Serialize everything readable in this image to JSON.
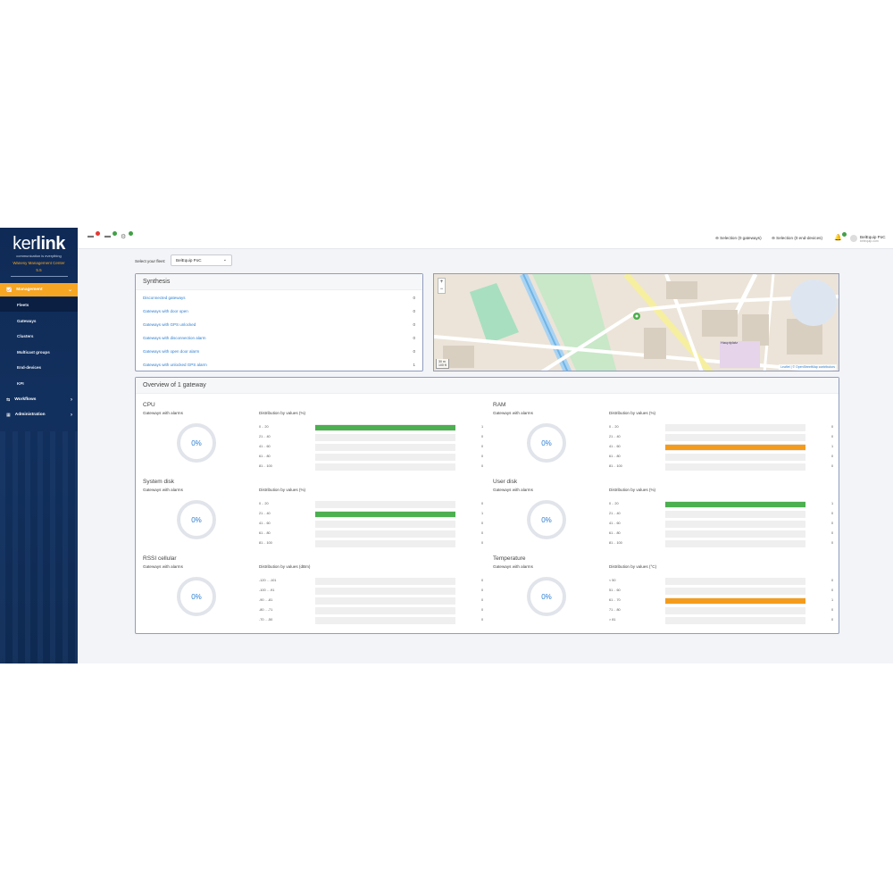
{
  "sidebar": {
    "brand_light": "ker",
    "brand_bold": "link",
    "tagline": "communication is everything",
    "product_line1": "Wanesy Management Center",
    "product_line2": "5.5",
    "sections": [
      {
        "label": "Management",
        "icon": "chart-line-icon",
        "active": true,
        "chevron": "⌄"
      },
      {
        "label": "Workflows",
        "icon": "workflow-icon",
        "active": false,
        "chevron": "›"
      },
      {
        "label": "Administration",
        "icon": "grid-icon",
        "active": false,
        "chevron": "›"
      }
    ],
    "items": [
      {
        "label": "Fleets",
        "active": true
      },
      {
        "label": "Gateways",
        "active": false
      },
      {
        "label": "Clusters",
        "active": false
      },
      {
        "label": "Multicast groups",
        "active": false
      },
      {
        "label": "End-devices",
        "active": false
      },
      {
        "label": "KPI",
        "active": false
      }
    ]
  },
  "topbar": {
    "icons": [
      {
        "name": "gateway-alarm-icon",
        "badge_color": "#e53935"
      },
      {
        "name": "gateway-status-icon",
        "badge_color": "#43a047"
      },
      {
        "name": "device-status-icon",
        "badge_color": "#43a047"
      }
    ],
    "selection_gateways": "Selection (0 gateways)",
    "selection_enddevices": "Selection (0 end-devices)",
    "user_name": "BelEquip PoC",
    "user_sub": "belequip.com"
  },
  "fleet": {
    "label": "Select your fleet:",
    "value": "BelEquip PoC"
  },
  "synthesis": {
    "title": "Synthesis",
    "rows": [
      {
        "label": "Disconnected gateways",
        "value": "0"
      },
      {
        "label": "Gateways with door open",
        "value": "0"
      },
      {
        "label": "Gateways with GPS unlocked",
        "value": "0"
      },
      {
        "label": "Gateways with disconnection alarm",
        "value": "0"
      },
      {
        "label": "Gateways with open door alarm",
        "value": "0"
      },
      {
        "label": "Gateways with unlocked GPS alarm",
        "value": "1"
      }
    ]
  },
  "map": {
    "zoom_in": "+",
    "zoom_out": "−",
    "scale_top": "30 m",
    "scale_bottom": "100 ft",
    "attribution": "Leaflet | © OpenStreetMap contributors",
    "place_hauptplatz": "Hauptplatz"
  },
  "overview": {
    "title": "Overview of 1 gateway",
    "alarms_label": "Gateways with alarms",
    "metrics": [
      {
        "title": "CPU",
        "percent": "0%",
        "dist_label": "Distribution by values (%)",
        "rows": [
          {
            "range": "0 .. 20",
            "count": "1",
            "fraction": 1,
            "color": "#4caf50"
          },
          {
            "range": "21 .. 40",
            "count": "0",
            "fraction": 0,
            "color": "#4caf50"
          },
          {
            "range": "41 .. 60",
            "count": "0",
            "fraction": 0,
            "color": "#4caf50"
          },
          {
            "range": "61 .. 80",
            "count": "0",
            "fraction": 0,
            "color": "#4caf50"
          },
          {
            "range": "81 .. 100",
            "count": "0",
            "fraction": 0,
            "color": "#4caf50"
          }
        ]
      },
      {
        "title": "RAM",
        "percent": "0%",
        "dist_label": "Distribution by values (%)",
        "rows": [
          {
            "range": "0 .. 20",
            "count": "0",
            "fraction": 0,
            "color": "#f59b1b"
          },
          {
            "range": "21 .. 40",
            "count": "0",
            "fraction": 0,
            "color": "#f59b1b"
          },
          {
            "range": "41 .. 60",
            "count": "1",
            "fraction": 1,
            "color": "#f59b1b"
          },
          {
            "range": "61 .. 80",
            "count": "0",
            "fraction": 0,
            "color": "#f59b1b"
          },
          {
            "range": "81 .. 100",
            "count": "0",
            "fraction": 0,
            "color": "#f59b1b"
          }
        ]
      },
      {
        "title": "System disk",
        "percent": "0%",
        "dist_label": "Distribution by values (%)",
        "rows": [
          {
            "range": "0 .. 20",
            "count": "0",
            "fraction": 0,
            "color": "#4caf50"
          },
          {
            "range": "21 .. 40",
            "count": "1",
            "fraction": 1,
            "color": "#4caf50"
          },
          {
            "range": "41 .. 60",
            "count": "0",
            "fraction": 0,
            "color": "#4caf50"
          },
          {
            "range": "61 .. 80",
            "count": "0",
            "fraction": 0,
            "color": "#4caf50"
          },
          {
            "range": "81 .. 100",
            "count": "0",
            "fraction": 0,
            "color": "#4caf50"
          }
        ]
      },
      {
        "title": "User disk",
        "percent": "0%",
        "dist_label": "Distribution by values (%)",
        "rows": [
          {
            "range": "0 .. 20",
            "count": "1",
            "fraction": 1,
            "color": "#4caf50"
          },
          {
            "range": "21 .. 40",
            "count": "0",
            "fraction": 0,
            "color": "#4caf50"
          },
          {
            "range": "41 .. 60",
            "count": "0",
            "fraction": 0,
            "color": "#4caf50"
          },
          {
            "range": "61 .. 80",
            "count": "0",
            "fraction": 0,
            "color": "#4caf50"
          },
          {
            "range": "81 .. 100",
            "count": "0",
            "fraction": 0,
            "color": "#4caf50"
          }
        ]
      },
      {
        "title": "RSSI cellular",
        "percent": "0%",
        "dist_label": "Distribution by values (dBm)",
        "rows": [
          {
            "range": "-120 .. -101",
            "count": "0",
            "fraction": 0,
            "color": "#4caf50"
          },
          {
            "range": "-100 .. -91",
            "count": "0",
            "fraction": 0,
            "color": "#4caf50"
          },
          {
            "range": "-90 .. -81",
            "count": "0",
            "fraction": 0,
            "color": "#4caf50"
          },
          {
            "range": "-80 .. -71",
            "count": "0",
            "fraction": 0,
            "color": "#4caf50"
          },
          {
            "range": "-70 .. -50",
            "count": "0",
            "fraction": 0,
            "color": "#4caf50"
          }
        ]
      },
      {
        "title": "Temperature",
        "percent": "0%",
        "dist_label": "Distribution by values (°C)",
        "rows": [
          {
            "range": "< 50",
            "count": "0",
            "fraction": 0,
            "color": "#f59b1b"
          },
          {
            "range": "51 .. 60",
            "count": "0",
            "fraction": 0,
            "color": "#f59b1b"
          },
          {
            "range": "61 .. 70",
            "count": "1",
            "fraction": 1,
            "color": "#f59b1b"
          },
          {
            "range": "71 .. 80",
            "count": "0",
            "fraction": 0,
            "color": "#f59b1b"
          },
          {
            "range": "> 81",
            "count": "0",
            "fraction": 0,
            "color": "#f59b1b"
          }
        ]
      }
    ]
  }
}
